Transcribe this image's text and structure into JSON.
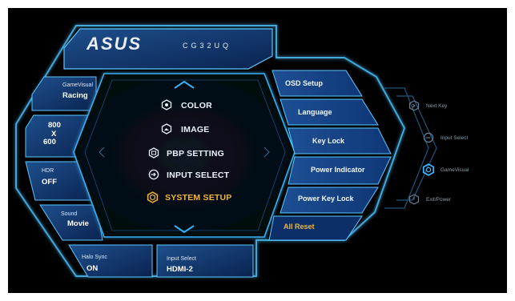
{
  "header": {
    "brand": "ASUS",
    "model": "CG32UQ"
  },
  "left_panel": [
    {
      "title": "GameVisual",
      "value": "Racing"
    },
    {
      "value_lines": [
        "800",
        "X",
        "600"
      ]
    },
    {
      "title": "HDR",
      "value": "OFF"
    },
    {
      "title": "Sound",
      "value": "Movie"
    },
    {
      "title": "Halo Sync",
      "value": "ON"
    }
  ],
  "bottom_info": {
    "title": "Input Select",
    "value": "HDMI-2"
  },
  "main_menu": [
    {
      "label": "COLOR",
      "icon": "color-icon"
    },
    {
      "label": "IMAGE",
      "icon": "image-icon"
    },
    {
      "label": "PBP SETTING",
      "icon": "pbp-icon"
    },
    {
      "label": "INPUT SELECT",
      "icon": "input-icon"
    },
    {
      "label": "SYSTEM SETUP",
      "icon": "system-setup-icon",
      "selected": true
    }
  ],
  "submenu": [
    {
      "label": "OSD Setup"
    },
    {
      "label": "Language"
    },
    {
      "label": "Key Lock"
    },
    {
      "label": "Power Indicator"
    },
    {
      "label": "Power Key Lock"
    },
    {
      "label": "All Reset",
      "selected": true
    }
  ],
  "nav_keys": [
    {
      "label": "Next Key",
      "icon": "next-key-icon"
    },
    {
      "label": "Input Select",
      "icon": "input-select-icon"
    },
    {
      "label": "GameVisual",
      "icon": "gamevisual-icon",
      "highlight": true
    },
    {
      "label": "Exit/Power",
      "icon": "exit-power-icon"
    }
  ],
  "colors": {
    "accent": "#f0b63a",
    "glow": "#37b6ff",
    "panel": "#0b2a57"
  }
}
